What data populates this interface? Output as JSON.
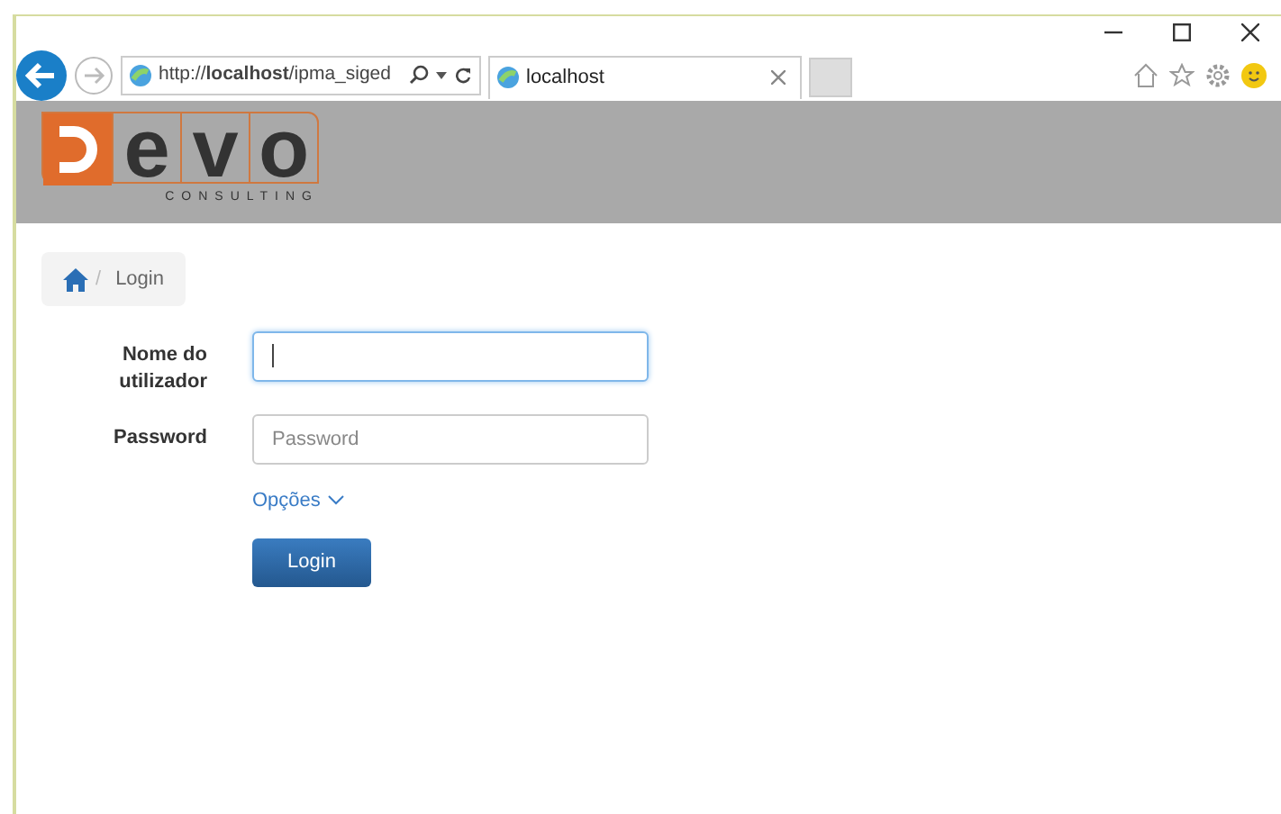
{
  "browser": {
    "address": "http://**localhost**/ipma_siged",
    "tab_title": "localhost"
  },
  "header": {
    "logo_letters": [
      "e",
      "v",
      "o"
    ],
    "logo_tagline": "CONSULTING"
  },
  "breadcrumb": {
    "separator": "/",
    "items": [
      "Login"
    ]
  },
  "form": {
    "fields": [
      {
        "label": "Nome do utilizador",
        "focused": true
      },
      {
        "label": "Password",
        "placeholder": "Password",
        "focused": false
      }
    ],
    "options_link": "Opções",
    "submit": "Login"
  }
}
